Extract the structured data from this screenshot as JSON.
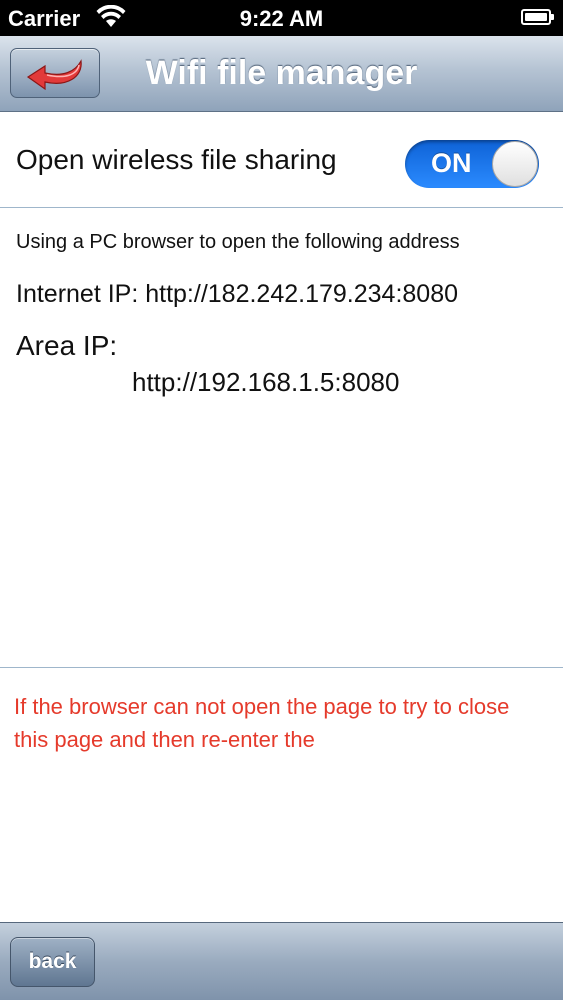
{
  "status_bar": {
    "carrier": "Carrier",
    "time": "9:22 AM",
    "wifi_icon": "wifi-icon",
    "battery_icon": "battery-icon"
  },
  "nav": {
    "title": "Wifi file manager",
    "back_icon": "curved-arrow-left-icon"
  },
  "sharing": {
    "label": "Open wireless file sharing",
    "toggle_text": "ON",
    "toggle_on": true,
    "accent": "#1a73e8"
  },
  "info": {
    "intro": "Using a PC browser to open the following address",
    "internet_ip": "Internet IP: http://182.242.179.234:8080",
    "area_label": "Area IP:",
    "area_url": "http://192.168.1.5:8080"
  },
  "hint": {
    "text": "If the browser can not open the page to try to close this page and then re-enter the",
    "color": "#e53a2b"
  },
  "toolbar": {
    "back_label": "back"
  }
}
